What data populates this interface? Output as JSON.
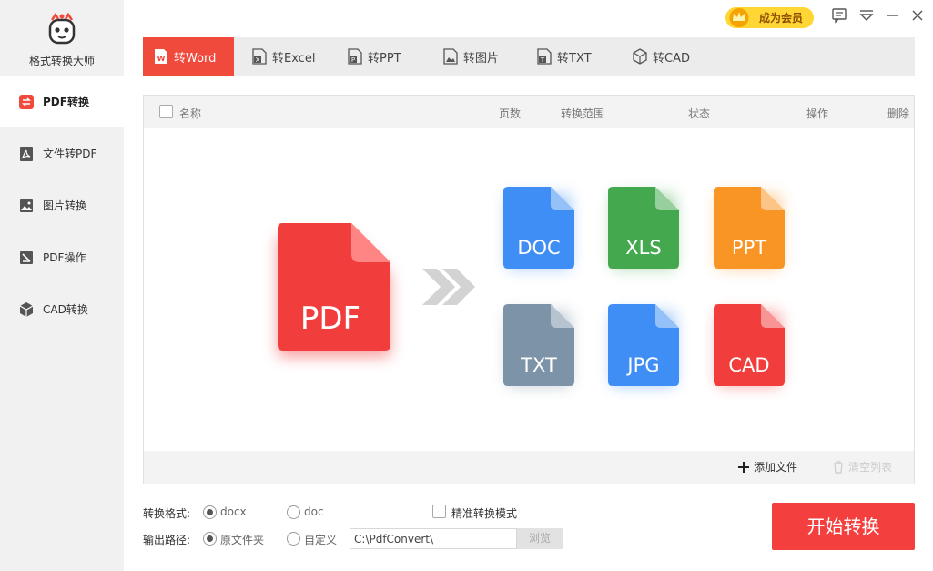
{
  "app": {
    "name": "格式转换大师"
  },
  "header": {
    "vip_label": "成为会员"
  },
  "sidebar": {
    "items": [
      {
        "label": "PDF转换",
        "icon": "pdf-convert-icon",
        "active": true
      },
      {
        "label": "文件转PDF",
        "icon": "acrobat-icon"
      },
      {
        "label": "图片转换",
        "icon": "image-icon"
      },
      {
        "label": "PDF操作",
        "icon": "pdf-edit-icon"
      },
      {
        "label": "CAD转换",
        "icon": "cube-icon"
      }
    ]
  },
  "tabs": [
    {
      "label": "转Word",
      "icon": "word-icon",
      "active": true
    },
    {
      "label": "转Excel",
      "icon": "excel-icon"
    },
    {
      "label": "转PPT",
      "icon": "ppt-icon"
    },
    {
      "label": "转图片",
      "icon": "picture-icon"
    },
    {
      "label": "转TXT",
      "icon": "txt-icon"
    },
    {
      "label": "转CAD",
      "icon": "cad-icon"
    }
  ],
  "table": {
    "columns": [
      "名称",
      "页数",
      "转换范围",
      "状态",
      "操作",
      "删除"
    ]
  },
  "illustration": {
    "source": "PDF",
    "targets": [
      "DOC",
      "XLS",
      "PPT",
      "TXT",
      "JPG",
      "CAD"
    ],
    "colors": {
      "PDF": "#f23d3d",
      "DOC": "#3f8ef5",
      "XLS": "#44a84f",
      "PPT": "#f99525",
      "TXT": "#7d93a8",
      "JPG": "#3f8ef5",
      "CAD": "#f23d3d"
    }
  },
  "footer": {
    "add_file": "添加文件",
    "clear_list": "清空列表"
  },
  "options": {
    "format_label": "转换格式:",
    "format_options": [
      "docx",
      "doc"
    ],
    "format_selected": "docx",
    "precise_mode": "精准转换模式",
    "output_label": "输出路径:",
    "output_options": [
      "原文件夹",
      "自定义"
    ],
    "output_selected": "原文件夹",
    "output_path": "C:\\PdfConvert\\",
    "browse": "浏览"
  },
  "start_button": "开始转换",
  "colors": {
    "accent": "#f43f3f",
    "vip": "#ffd633"
  }
}
